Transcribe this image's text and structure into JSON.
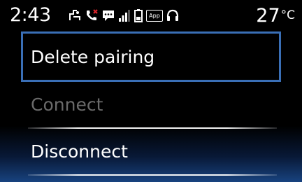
{
  "status_bar": {
    "time": "2:43",
    "temperature": "27",
    "temperature_unit": "°C",
    "icons": [
      "navigation-route-icon",
      "phone-missed-call-icon",
      "message-icon",
      "signal-strength-icon",
      "battery-icon",
      "app-icon",
      "headset-icon"
    ],
    "app_icon_label": "App"
  },
  "menu": {
    "items": [
      {
        "label": "Delete pairing",
        "state": "selected"
      },
      {
        "label": "Connect",
        "state": "disabled"
      },
      {
        "label": "Disconnect",
        "state": "enabled"
      }
    ]
  },
  "colors": {
    "background": "#000000",
    "selection_border": "#3a6fb6",
    "disabled_text": "#6a6a6a",
    "missed_call_red": "#e0242b",
    "bottom_glow_blue": "#1c4e96"
  }
}
